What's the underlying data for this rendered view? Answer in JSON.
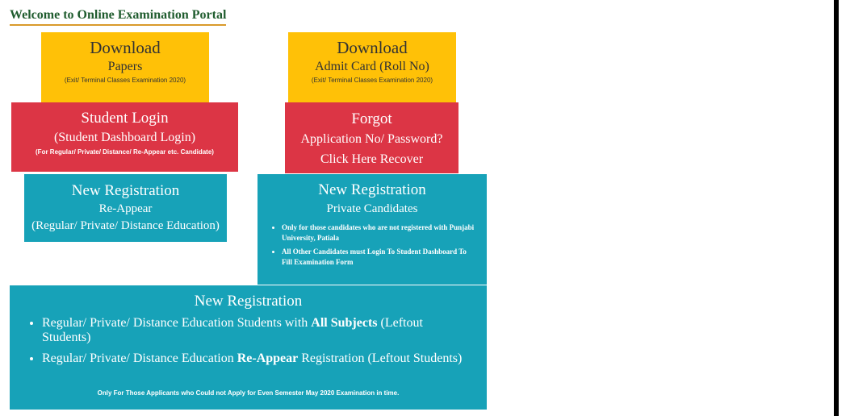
{
  "page": {
    "title": "Welcome to Online Examination Portal"
  },
  "cards": {
    "download_papers": {
      "line1": "Download",
      "line2": "Papers",
      "note": "(Exit/ Terminal Classes Examination 2020)"
    },
    "download_admit": {
      "line1": "Download",
      "line2": "Admit Card (Roll No)",
      "note": "(Exit/ Terminal Classes Examination 2020)"
    },
    "student_login": {
      "line1": "Student Login",
      "line2": "(Student Dashboard Login)",
      "note": "(For Regular/ Private/ Distance/ Re-Appear etc. Candidate)"
    },
    "forgot": {
      "line1": "Forgot",
      "line2": "Application No/ Password?",
      "line3": "Click Here Recover"
    },
    "reg_reappear": {
      "line1": "New Registration",
      "line2": "Re-Appear",
      "line3": "(Regular/ Private/ Distance Education)"
    },
    "reg_private": {
      "line1": "New Registration",
      "line2": "Private Candidates",
      "bullets": [
        "Only for those candidates who are not registered with Punjabi University, Patiala",
        "All Other Candidates must Login To Student Dashboard To Fill Examination Form"
      ]
    },
    "reg_leftout": {
      "line1": "New Registration",
      "bullet1_a": "Regular/ Private/ Distance Education Students with ",
      "bullet1_b": "All Subjects",
      "bullet1_c": " (Leftout Students)",
      "bullet2_a": "Regular/ Private/ Distance Education ",
      "bullet2_b": "Re-Appear",
      "bullet2_c": " Registration (Leftout Students)",
      "note": "Only For Those Applicants who Could not Apply for Even Semester May 2020 Examination in time."
    }
  },
  "colors": {
    "yellow": "#ffc107",
    "red": "#dc3545",
    "teal": "#17a2b8",
    "title_green": "#1f5c2e",
    "title_underline": "#d99a2b"
  }
}
